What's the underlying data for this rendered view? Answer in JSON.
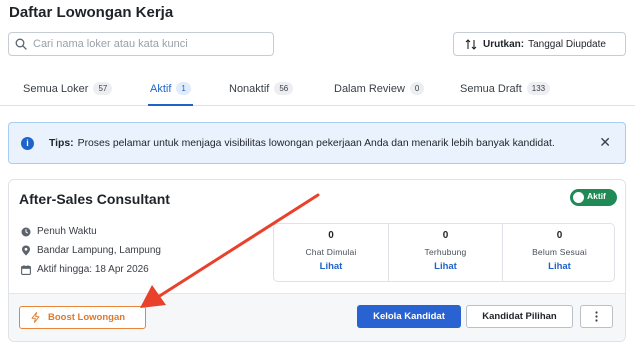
{
  "page": {
    "title": "Daftar Lowongan Kerja"
  },
  "search": {
    "placeholder": "Cari nama loker atau kata kunci",
    "value": ""
  },
  "sort": {
    "label": "Urutkan:",
    "value": "Tanggal Diupdate"
  },
  "tabs": [
    {
      "label": "Semua Loker",
      "count": "57",
      "active": false
    },
    {
      "label": "Aktif",
      "count": "1",
      "active": true
    },
    {
      "label": "Nonaktif",
      "count": "56",
      "active": false
    },
    {
      "label": "Dalam Review",
      "count": "0",
      "active": false
    },
    {
      "label": "Semua Draft",
      "count": "133",
      "active": false
    }
  ],
  "tips": {
    "label": "Tips:",
    "text": "Proses pelamar untuk menjaga visibilitas lowongan pekerjaan Anda dan menarik lebih banyak kandidat."
  },
  "job": {
    "title": "After-Sales Consultant",
    "status": "Aktif",
    "employment_type": "Penuh Waktu",
    "location": "Bandar Lampung, Lampung",
    "active_until": "Aktif hingga: 18 Apr 2026",
    "stats": [
      {
        "value": "0",
        "label": "Chat Dimulai",
        "link": "Lihat"
      },
      {
        "value": "0",
        "label": "Terhubung",
        "link": "Lihat"
      },
      {
        "value": "0",
        "label": "Belum Sesuai",
        "link": "Lihat"
      }
    ],
    "actions": {
      "boost": "Boost Lowongan",
      "manage": "Kelola Kandidat",
      "chosen": "Kandidat Pilihan"
    }
  },
  "colors": {
    "primary": "#2962d1",
    "active_tab": "#1e63c9",
    "status_green": "#1f8a55",
    "boost_orange": "#e0792b",
    "tips_bg": "#eaf3fd",
    "annotation_arrow": "#e8412c"
  },
  "icons": {
    "search": "search-icon",
    "sort": "sort-arrows-icon",
    "info": "info-icon",
    "close": "close-icon",
    "clock": "clock-icon",
    "location": "location-pin-icon",
    "calendar": "calendar-icon",
    "bolt": "lightning-icon",
    "more": "more-vertical-icon"
  }
}
